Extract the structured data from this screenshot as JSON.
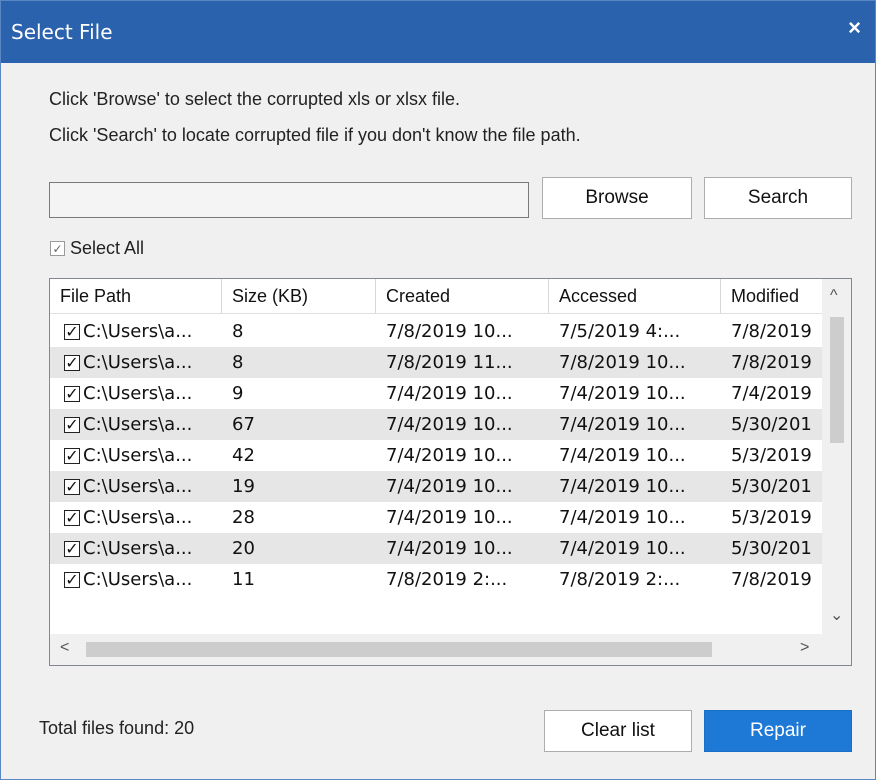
{
  "dialog": {
    "title": "Select File",
    "close_glyph": "×",
    "instructions": [
      "Click 'Browse' to select the corrupted xls or xlsx file.",
      "Click 'Search' to locate corrupted file if you don't know the file path."
    ],
    "path_value": "",
    "browse_label": "Browse",
    "search_label": "Search",
    "select_all": {
      "label": "Select All",
      "checked": true
    },
    "table": {
      "columns": [
        "File Path",
        "Size (KB)",
        "Created",
        "Accessed",
        "Modified"
      ],
      "rows": [
        {
          "checked": true,
          "path": "C:\\Users\\a...",
          "size": "8",
          "created": "7/8/2019 10...",
          "accessed": "7/5/2019 4:...",
          "modified": "7/8/2019"
        },
        {
          "checked": true,
          "path": "C:\\Users\\a...",
          "size": "8",
          "created": "7/8/2019 11...",
          "accessed": "7/8/2019 10...",
          "modified": "7/8/2019"
        },
        {
          "checked": true,
          "path": "C:\\Users\\a...",
          "size": "9",
          "created": "7/4/2019 10...",
          "accessed": "7/4/2019 10...",
          "modified": "7/4/2019"
        },
        {
          "checked": true,
          "path": "C:\\Users\\a...",
          "size": "67",
          "created": "7/4/2019 10...",
          "accessed": "7/4/2019 10...",
          "modified": "5/30/201"
        },
        {
          "checked": true,
          "path": "C:\\Users\\a...",
          "size": "42",
          "created": "7/4/2019 10...",
          "accessed": "7/4/2019 10...",
          "modified": "5/3/2019"
        },
        {
          "checked": true,
          "path": "C:\\Users\\a...",
          "size": "19",
          "created": "7/4/2019 10...",
          "accessed": "7/4/2019 10...",
          "modified": "5/30/201"
        },
        {
          "checked": true,
          "path": "C:\\Users\\a...",
          "size": "28",
          "created": "7/4/2019 10...",
          "accessed": "7/4/2019 10...",
          "modified": "5/3/2019"
        },
        {
          "checked": true,
          "path": "C:\\Users\\a...",
          "size": "20",
          "created": "7/4/2019 10...",
          "accessed": "7/4/2019 10...",
          "modified": "5/30/201"
        },
        {
          "checked": true,
          "path": "C:\\Users\\a...",
          "size": "11",
          "created": "7/8/2019 2:...",
          "accessed": "7/8/2019 2:...",
          "modified": "7/8/2019"
        }
      ]
    },
    "scroll": {
      "up": "^",
      "down": "⌄",
      "left": "<",
      "right": ">"
    },
    "footer": {
      "total_label": "Total files found:",
      "total_count": "20",
      "clear_label": "Clear list",
      "repair_label": "Repair"
    },
    "colors": {
      "titlebar": "#2b62ad",
      "primary_button": "#1e78d6",
      "alt_row": "#e6e6e6",
      "dialog_bg": "#f0f0f0"
    }
  }
}
